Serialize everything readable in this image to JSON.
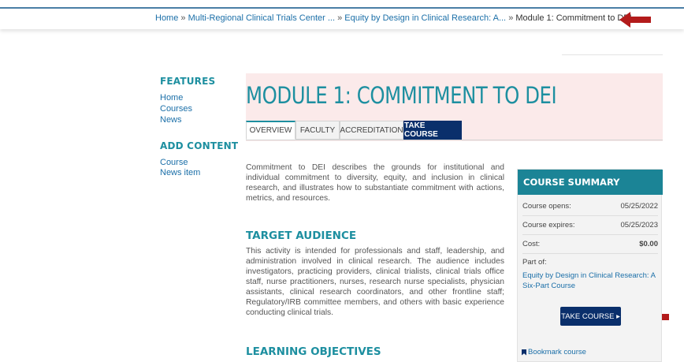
{
  "breadcrumb": {
    "home": "Home",
    "sep": "»",
    "center": "Multi-Regional Clinical Trials Center ...",
    "course": "Equity by Design in Clinical Research: A...",
    "current": "Module 1: Commitment to DEI"
  },
  "sidebar": {
    "features_heading": "FEATURES",
    "features": [
      "Home",
      "Courses",
      "News"
    ],
    "add_heading": "ADD CONTENT",
    "add_items": [
      "Course",
      "News item"
    ]
  },
  "module": {
    "title": "MODULE 1: COMMITMENT TO DEI",
    "tabs": [
      "OVERVIEW",
      "FACULTY",
      "ACCREDITATION",
      "TAKE COURSE"
    ]
  },
  "content": {
    "intro": "Commitment to DEI describes the grounds for institutional and individual commitment to diversity, equity, and inclusion in clinical research, and illustrates how to substantiate commitment with actions, metrics, and resources.",
    "target_heading": "TARGET AUDIENCE",
    "target_text": "This activity is intended for professionals and staff, leadership, and administration involved in clinical research. The audience includes investigators, practicing providers, clinical trialists, clinical trials office staff, nurse practitioners, nurses, research nurse specialists, physician assistants, clinical research coordinators, and other frontline staff; Regulatory/IRB committee members, and others with basic experience conducting clinical trials.",
    "objectives_heading": "LEARNING OBJECTIVES"
  },
  "summary": {
    "heading": "COURSE SUMMARY",
    "opens_label": "Course opens:",
    "opens_value": "05/25/2022",
    "expires_label": "Course expires:",
    "expires_value": "05/25/2023",
    "cost_label": "Cost:",
    "cost_value": "$0.00",
    "part_of_label": "Part of:",
    "part_of_link": "Equity by Design in Clinical Research: A Six-Part Course",
    "take_course": "TAKE COURSE ▸",
    "bookmark": "Bookmark course"
  },
  "colors": {
    "teal": "#1d8fa0",
    "navy": "#0a2f6b",
    "link": "#1b6fa8",
    "arrow": "#b31b1b"
  }
}
